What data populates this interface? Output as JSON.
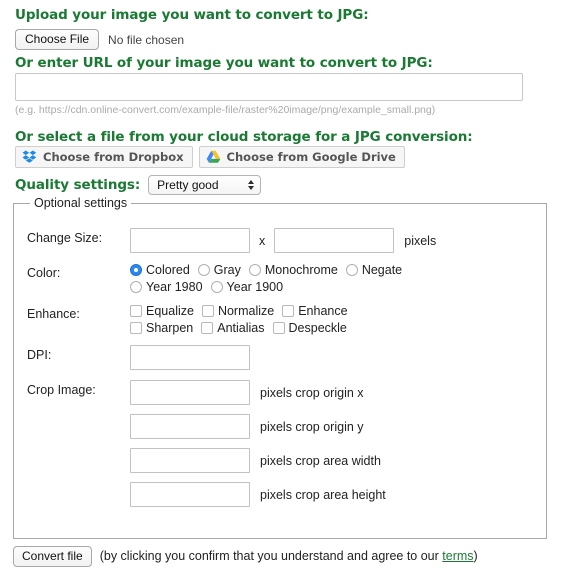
{
  "upload": {
    "heading": "Upload your image you want to convert to JPG:",
    "choose_file_label": "Choose File",
    "no_file_text": "No file chosen"
  },
  "url": {
    "heading": "Or enter URL of your image you want to convert to JPG:",
    "value": "",
    "placeholder": "",
    "hint": "(e.g. https://cdn.online-convert.com/example-file/raster%20image/png/example_small.png)"
  },
  "cloud": {
    "heading": "Or select a file from your cloud storage for a JPG conversion:",
    "dropbox_label": "Choose from Dropbox",
    "gdrive_label": "Choose from Google Drive",
    "dropbox_color": "#1e8ae5",
    "gdrive_colors": {
      "blue": "#4386fa",
      "green": "#3aa757",
      "yellow": "#f8c12a"
    }
  },
  "quality": {
    "label": "Quality settings:",
    "selected": "Pretty good",
    "options": [
      "Pretty good"
    ]
  },
  "optional": {
    "legend": "Optional settings",
    "change_size": {
      "label": "Change Size:",
      "width_value": "",
      "height_value": "",
      "separator": "x",
      "unit": "pixels"
    },
    "color": {
      "label": "Color:",
      "selected": "Colored",
      "accent": "#2b88f0",
      "options_row1": [
        "Colored",
        "Gray",
        "Monochrome",
        "Negate"
      ],
      "options_row2": [
        "Year 1980",
        "Year 1900"
      ]
    },
    "enhance": {
      "label": "Enhance:",
      "options_row1": [
        "Equalize",
        "Normalize",
        "Enhance"
      ],
      "options_row2": [
        "Sharpen",
        "Antialias",
        "Despeckle"
      ],
      "checked": []
    },
    "dpi": {
      "label": "DPI:",
      "value": ""
    },
    "crop": {
      "label": "Crop Image:",
      "fields": [
        {
          "value": "",
          "unit": "pixels crop origin x"
        },
        {
          "value": "",
          "unit": "pixels crop origin y"
        },
        {
          "value": "",
          "unit": "pixels crop area width"
        },
        {
          "value": "",
          "unit": "pixels crop area height"
        }
      ]
    }
  },
  "footer": {
    "convert_label": "Convert file",
    "agree_prefix": "(by clicking you confirm that you understand and agree to our ",
    "terms_label": "terms",
    "agree_suffix": ")"
  },
  "theme": {
    "heading_green": "#1a7a33",
    "link_green": "#1a7a33",
    "border_gray": "#a9a9a9"
  }
}
